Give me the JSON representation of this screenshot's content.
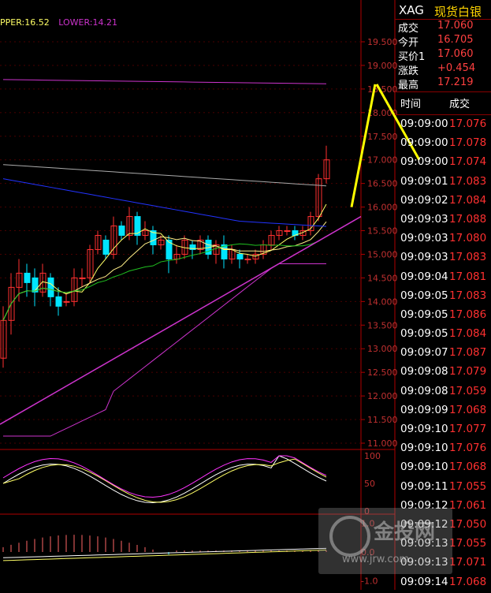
{
  "header": {
    "symbol": "XAG",
    "name": "现货白银"
  },
  "quote": [
    {
      "k": "成交",
      "v": "17.060"
    },
    {
      "k": "今开",
      "v": "16.705"
    },
    {
      "k": "买价1",
      "v": "17.060"
    },
    {
      "k": "涨跌",
      "v": "+0.454"
    },
    {
      "k": "最高",
      "v": "17.219"
    }
  ],
  "ticks_header": {
    "time": "时间",
    "price": "成交"
  },
  "ticks": [
    {
      "t": "09:09:00",
      "p": "17.076"
    },
    {
      "t": "09:09:00",
      "p": "17.078"
    },
    {
      "t": "09:09:00",
      "p": "17.074"
    },
    {
      "t": "09:09:01",
      "p": "17.083"
    },
    {
      "t": "09:09:02",
      "p": "17.084"
    },
    {
      "t": "09:09:03",
      "p": "17.088"
    },
    {
      "t": "09:09:03",
      "p": "17.080"
    },
    {
      "t": "09:09:03",
      "p": "17.083"
    },
    {
      "t": "09:09:04",
      "p": "17.081"
    },
    {
      "t": "09:09:05",
      "p": "17.083"
    },
    {
      "t": "09:09:05",
      "p": "17.086"
    },
    {
      "t": "09:09:05",
      "p": "17.084"
    },
    {
      "t": "09:09:07",
      "p": "17.087"
    },
    {
      "t": "09:09:08",
      "p": "17.079"
    },
    {
      "t": "09:09:08",
      "p": "17.059"
    },
    {
      "t": "09:09:09",
      "p": "17.068"
    },
    {
      "t": "09:09:10",
      "p": "17.077"
    },
    {
      "t": "09:09:10",
      "p": "17.076"
    },
    {
      "t": "09:09:10",
      "p": "17.068"
    },
    {
      "t": "09:09:11",
      "p": "17.055"
    },
    {
      "t": "09:09:12",
      "p": "17.061"
    },
    {
      "t": "09:09:12",
      "p": "17.050"
    },
    {
      "t": "09:09:13",
      "p": "17.055"
    },
    {
      "t": "09:09:13",
      "p": "17.071"
    },
    {
      "t": "09:09:14",
      "p": "17.068"
    }
  ],
  "legend": {
    "upper": "PPER:16.52",
    "lower": "LOWER:14.21"
  },
  "watermark": {
    "text": "金投网",
    "url": "www.jrw.com"
  },
  "colors": {
    "up": "#ff3030",
    "down": "#00e5ff",
    "ma1": "#ffff66",
    "ma2": "#2233ff",
    "ma3": "#20c020",
    "band": "#cc33cc",
    "ma4": "#aaaaaa",
    "axis": "#b00000"
  },
  "chart_data": {
    "type": "candlestick",
    "price_axis": {
      "ticks": [
        "19.500",
        "19.000",
        "18.500",
        "18.000",
        "17.500",
        "17.000",
        "16.500",
        "16.000",
        "15.500",
        "15.000",
        "14.500",
        "14.000",
        "13.500",
        "13.000",
        "12.500",
        "12.000",
        "11.500",
        "11.000"
      ],
      "range": [
        11.0,
        19.8
      ]
    },
    "candles": [
      [
        12.8,
        13.6,
        12.6,
        13.9
      ],
      [
        13.6,
        14.3,
        13.3,
        14.6
      ],
      [
        14.3,
        14.6,
        14.0,
        14.9
      ],
      [
        14.6,
        14.4,
        14.1,
        14.8
      ],
      [
        14.5,
        14.2,
        13.9,
        14.7
      ],
      [
        14.2,
        14.6,
        14.1,
        14.8
      ],
      [
        14.5,
        14.1,
        13.9,
        14.6
      ],
      [
        14.1,
        13.9,
        13.7,
        14.3
      ],
      [
        14.0,
        14.0,
        13.9,
        14.2
      ],
      [
        14.0,
        14.5,
        13.9,
        14.7
      ],
      [
        14.5,
        14.5,
        14.3,
        14.7
      ],
      [
        14.5,
        15.1,
        14.4,
        15.2
      ],
      [
        15.1,
        15.4,
        15.0,
        15.5
      ],
      [
        15.3,
        15.0,
        14.9,
        15.4
      ],
      [
        15.0,
        15.6,
        14.9,
        15.8
      ],
      [
        15.6,
        15.4,
        15.3,
        15.7
      ],
      [
        15.4,
        15.8,
        15.3,
        16.0
      ],
      [
        15.8,
        15.4,
        15.2,
        15.9
      ],
      [
        15.4,
        15.5,
        15.3,
        15.7
      ],
      [
        15.5,
        15.2,
        15.0,
        15.6
      ],
      [
        15.2,
        15.3,
        15.1,
        15.4
      ],
      [
        15.3,
        14.9,
        14.6,
        15.4
      ],
      [
        14.9,
        15.0,
        14.8,
        15.2
      ],
      [
        15.0,
        15.3,
        14.9,
        15.4
      ],
      [
        15.2,
        15.1,
        14.9,
        15.3
      ],
      [
        15.1,
        15.3,
        15.0,
        15.4
      ],
      [
        15.3,
        15.0,
        14.9,
        15.4
      ],
      [
        15.0,
        15.2,
        14.8,
        15.3
      ],
      [
        15.2,
        14.9,
        14.7,
        15.4
      ],
      [
        14.9,
        15.1,
        14.8,
        15.2
      ],
      [
        15.0,
        14.9,
        14.7,
        15.1
      ],
      [
        14.9,
        14.9,
        14.8,
        15.0
      ],
      [
        14.9,
        15.0,
        14.8,
        15.1
      ],
      [
        15.0,
        15.2,
        14.9,
        15.3
      ],
      [
        15.2,
        15.4,
        15.1,
        15.5
      ],
      [
        15.4,
        15.5,
        15.3,
        15.6
      ],
      [
        15.5,
        15.5,
        15.4,
        15.6
      ],
      [
        15.5,
        15.4,
        15.3,
        15.6
      ],
      [
        15.4,
        15.5,
        15.3,
        15.6
      ],
      [
        15.5,
        15.8,
        15.4,
        15.9
      ],
      [
        15.8,
        16.6,
        15.7,
        16.7
      ],
      [
        16.6,
        17.0,
        16.5,
        17.3
      ]
    ],
    "osc_axis": {
      "ticks": [
        "100",
        "50",
        "0"
      ]
    },
    "macd_axis": {
      "ticks": [
        "1.0",
        "0.0",
        "-1.0"
      ]
    }
  }
}
